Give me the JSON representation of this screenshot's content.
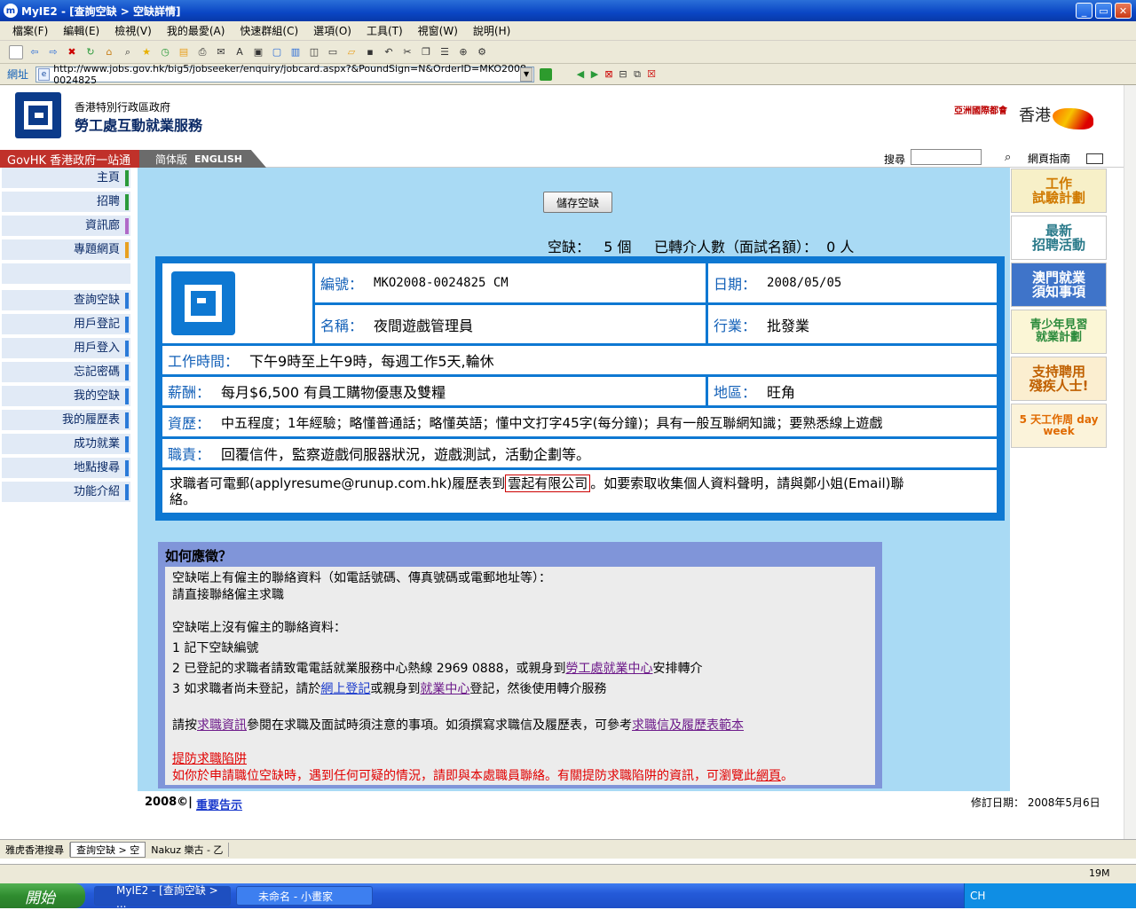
{
  "window": {
    "title": "MyIE2 - [查詢空缺 > 空缺詳情]"
  },
  "menu": [
    "檔案(F)",
    "編輯(E)",
    "檢視(V)",
    "我的最愛(A)",
    "快速群組(C)",
    "選項(O)",
    "工具(T)",
    "視窗(W)",
    "說明(H)"
  ],
  "address": {
    "label": "網址",
    "url": "http://www.jobs.gov.hk/big5/jobseeker/enquiry/jobcard.aspx?&PoundSign=N&OrderID=MKO2008-0024825"
  },
  "header": {
    "org_line1": "香港特別行政區政府",
    "org_line2": "勞工處互動就業服務",
    "brand_small": "亞洲國際都會",
    "brand_hk": "香港"
  },
  "nav": {
    "govhk": "GovHK 香港政府一站通",
    "simplified": "简体版",
    "english": "ENGLISH",
    "search_label": "搜尋",
    "guide": "網頁指南"
  },
  "sidebar": [
    {
      "label": "主頁",
      "color": "#2a9a3a"
    },
    {
      "label": "招聘",
      "color": "#2a9a3a"
    },
    {
      "label": "資訊廊",
      "color": "#b06ac8"
    },
    {
      "label": "專題網頁",
      "color": "#e8a020"
    },
    {
      "label": "查詢空缺",
      "color": "#2a7ad8"
    },
    {
      "label": "用戶登記",
      "color": "#2a7ad8"
    },
    {
      "label": "用戶登入",
      "color": "#2a7ad8"
    },
    {
      "label": "忘記密碼",
      "color": "#2a7ad8"
    },
    {
      "label": "我的空缺",
      "color": "#2a7ad8"
    },
    {
      "label": "我的履歷表",
      "color": "#2a7ad8"
    },
    {
      "label": "成功就業",
      "color": "#2a7ad8"
    },
    {
      "label": "地點搜尋",
      "color": "#2a7ad8"
    },
    {
      "label": "功能介紹",
      "color": "#2a7ad8"
    }
  ],
  "ads": [
    {
      "text": "工作\n試驗計劃",
      "bg": "#f7f0c8",
      "color": "#d07a00"
    },
    {
      "text": "最新\n招聘活動",
      "bg": "#ffffff",
      "color": "#2a7a8a"
    },
    {
      "text": "澳門就業\n須知事項",
      "bg": "#3f74c9",
      "color": "#ffffff"
    },
    {
      "text": "青少年見習\n就業計劃",
      "bg": "#fbf6d6",
      "color": "#2a8a3a"
    },
    {
      "text": "支持聘用\n殘疾人士!",
      "bg": "#fbeed0",
      "color": "#c06000"
    },
    {
      "text": "5 天工作周 day week",
      "bg": "#fbf3da",
      "color": "#e06a00"
    }
  ],
  "main": {
    "save_button": "儲存空缺",
    "vacancy_line": "空缺：   5 個     已轉介人數（面試名額）：  0 人"
  },
  "job": {
    "no_label": "編號：",
    "no": "MKO2008-0024825 CM",
    "date_label": "日期：",
    "date": "2008/05/05",
    "name_label": "名稱：",
    "name": "夜間遊戲管理員",
    "industry_label": "行業：",
    "industry": "批發業",
    "hours_label": "工作時間：",
    "hours": "下午9時至上午9時，每週工作5天,輪休",
    "salary_label": "薪酬：",
    "salary": "每月$6,500 有員工購物優惠及雙糧",
    "district_label": "地區：",
    "district": "旺角",
    "qual_label": "資歷：",
    "qual": "中五程度；1年經驗；略懂普通話；略懂英語；懂中文打字45字(每分鐘)；具有一般互聯網知識；要熟悉線上遊戲",
    "duty_label": "職責：",
    "duty": "回覆信件，監察遊戲伺服器狀況，遊戲測試，活動企劃等。",
    "apply_pre": "求職者可電郵(applyresume@runup.com.hk)履歷表到",
    "company": "雲起有限公司",
    "apply_post": "。如要索取收集個人資料聲明，請與鄭小姐(Email)聯",
    "apply_post2": "絡。"
  },
  "howto": {
    "title": "如何應徵？",
    "l1": "空缺啱上有僱主的聯絡資料（如電話號碼、傳真號碼或電郵地址等）：",
    "l2": "請直接聯絡僱主求職",
    "l3": "空缺啱上沒有僱主的聯絡資料：",
    "s1": "1  記下空缺編號",
    "s2a": "2  已登記的求職者請致電電話就業服務中心熱線 2969 0888，或親身到",
    "s2link": "勞工處就業中心",
    "s2b": "安排轉介",
    "s3a": "3  如求職者尚未登記，請於",
    "s3link1": "網上登記",
    "s3b": "或親身到",
    "s3link2": "就業中心",
    "s3c": "登記，然後使用轉介服務",
    "t1": "請按",
    "t1link": "求職資訊",
    "t2": "參閱在求職及面試時須注意的事項。如須撰寫求職信及履歷表，可參考",
    "t2link": "求職信及履歷表範本",
    "warn_title": "提防求職陷阱",
    "warn_a": "如你於申請職位空缺時，遇到任何可疑的情況，請即與本處職員聯絡。有關提防求職陷阱的資訊，可瀏覽此",
    "warn_link": "網頁",
    "warn_b": "。"
  },
  "footer": {
    "year": "2008©|",
    "notice": "重要告示",
    "revised": "修訂日期：  2008年5月6日"
  },
  "links": [
    "雅虎香港搜尋",
    "查詢空缺 > 空",
    "Nakuz 樂古 - 乙"
  ],
  "taskbar": {
    "start": "開始",
    "task1": "MyIE2 - [查詢空缺 > ...",
    "task2": "未命名 - 小畫家",
    "tray": "CH",
    "status": "19M"
  }
}
